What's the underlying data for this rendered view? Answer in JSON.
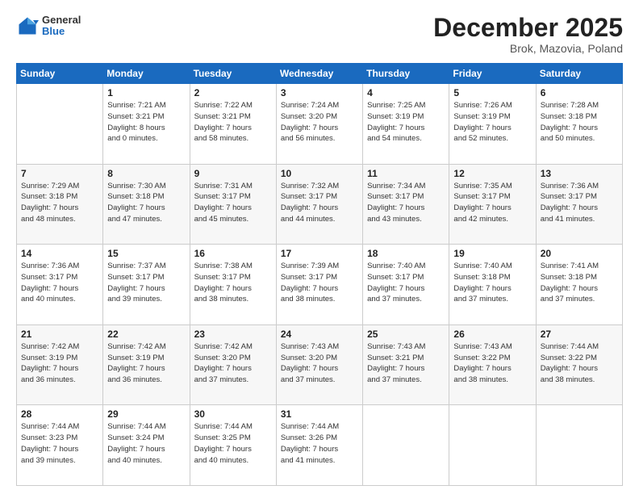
{
  "header": {
    "logo": {
      "general": "General",
      "blue": "Blue"
    },
    "title": "December 2025",
    "subtitle": "Brok, Mazovia, Poland"
  },
  "days_of_week": [
    "Sunday",
    "Monday",
    "Tuesday",
    "Wednesday",
    "Thursday",
    "Friday",
    "Saturday"
  ],
  "weeks": [
    [
      {
        "day": "",
        "lines": []
      },
      {
        "day": "1",
        "lines": [
          "Sunrise: 7:21 AM",
          "Sunset: 3:21 PM",
          "Daylight: 8 hours",
          "and 0 minutes."
        ]
      },
      {
        "day": "2",
        "lines": [
          "Sunrise: 7:22 AM",
          "Sunset: 3:21 PM",
          "Daylight: 7 hours",
          "and 58 minutes."
        ]
      },
      {
        "day": "3",
        "lines": [
          "Sunrise: 7:24 AM",
          "Sunset: 3:20 PM",
          "Daylight: 7 hours",
          "and 56 minutes."
        ]
      },
      {
        "day": "4",
        "lines": [
          "Sunrise: 7:25 AM",
          "Sunset: 3:19 PM",
          "Daylight: 7 hours",
          "and 54 minutes."
        ]
      },
      {
        "day": "5",
        "lines": [
          "Sunrise: 7:26 AM",
          "Sunset: 3:19 PM",
          "Daylight: 7 hours",
          "and 52 minutes."
        ]
      },
      {
        "day": "6",
        "lines": [
          "Sunrise: 7:28 AM",
          "Sunset: 3:18 PM",
          "Daylight: 7 hours",
          "and 50 minutes."
        ]
      }
    ],
    [
      {
        "day": "7",
        "lines": [
          "Sunrise: 7:29 AM",
          "Sunset: 3:18 PM",
          "Daylight: 7 hours",
          "and 48 minutes."
        ]
      },
      {
        "day": "8",
        "lines": [
          "Sunrise: 7:30 AM",
          "Sunset: 3:18 PM",
          "Daylight: 7 hours",
          "and 47 minutes."
        ]
      },
      {
        "day": "9",
        "lines": [
          "Sunrise: 7:31 AM",
          "Sunset: 3:17 PM",
          "Daylight: 7 hours",
          "and 45 minutes."
        ]
      },
      {
        "day": "10",
        "lines": [
          "Sunrise: 7:32 AM",
          "Sunset: 3:17 PM",
          "Daylight: 7 hours",
          "and 44 minutes."
        ]
      },
      {
        "day": "11",
        "lines": [
          "Sunrise: 7:34 AM",
          "Sunset: 3:17 PM",
          "Daylight: 7 hours",
          "and 43 minutes."
        ]
      },
      {
        "day": "12",
        "lines": [
          "Sunrise: 7:35 AM",
          "Sunset: 3:17 PM",
          "Daylight: 7 hours",
          "and 42 minutes."
        ]
      },
      {
        "day": "13",
        "lines": [
          "Sunrise: 7:36 AM",
          "Sunset: 3:17 PM",
          "Daylight: 7 hours",
          "and 41 minutes."
        ]
      }
    ],
    [
      {
        "day": "14",
        "lines": [
          "Sunrise: 7:36 AM",
          "Sunset: 3:17 PM",
          "Daylight: 7 hours",
          "and 40 minutes."
        ]
      },
      {
        "day": "15",
        "lines": [
          "Sunrise: 7:37 AM",
          "Sunset: 3:17 PM",
          "Daylight: 7 hours",
          "and 39 minutes."
        ]
      },
      {
        "day": "16",
        "lines": [
          "Sunrise: 7:38 AM",
          "Sunset: 3:17 PM",
          "Daylight: 7 hours",
          "and 38 minutes."
        ]
      },
      {
        "day": "17",
        "lines": [
          "Sunrise: 7:39 AM",
          "Sunset: 3:17 PM",
          "Daylight: 7 hours",
          "and 38 minutes."
        ]
      },
      {
        "day": "18",
        "lines": [
          "Sunrise: 7:40 AM",
          "Sunset: 3:17 PM",
          "Daylight: 7 hours",
          "and 37 minutes."
        ]
      },
      {
        "day": "19",
        "lines": [
          "Sunrise: 7:40 AM",
          "Sunset: 3:18 PM",
          "Daylight: 7 hours",
          "and 37 minutes."
        ]
      },
      {
        "day": "20",
        "lines": [
          "Sunrise: 7:41 AM",
          "Sunset: 3:18 PM",
          "Daylight: 7 hours",
          "and 37 minutes."
        ]
      }
    ],
    [
      {
        "day": "21",
        "lines": [
          "Sunrise: 7:42 AM",
          "Sunset: 3:19 PM",
          "Daylight: 7 hours",
          "and 36 minutes."
        ]
      },
      {
        "day": "22",
        "lines": [
          "Sunrise: 7:42 AM",
          "Sunset: 3:19 PM",
          "Daylight: 7 hours",
          "and 36 minutes."
        ]
      },
      {
        "day": "23",
        "lines": [
          "Sunrise: 7:42 AM",
          "Sunset: 3:20 PM",
          "Daylight: 7 hours",
          "and 37 minutes."
        ]
      },
      {
        "day": "24",
        "lines": [
          "Sunrise: 7:43 AM",
          "Sunset: 3:20 PM",
          "Daylight: 7 hours",
          "and 37 minutes."
        ]
      },
      {
        "day": "25",
        "lines": [
          "Sunrise: 7:43 AM",
          "Sunset: 3:21 PM",
          "Daylight: 7 hours",
          "and 37 minutes."
        ]
      },
      {
        "day": "26",
        "lines": [
          "Sunrise: 7:43 AM",
          "Sunset: 3:22 PM",
          "Daylight: 7 hours",
          "and 38 minutes."
        ]
      },
      {
        "day": "27",
        "lines": [
          "Sunrise: 7:44 AM",
          "Sunset: 3:22 PM",
          "Daylight: 7 hours",
          "and 38 minutes."
        ]
      }
    ],
    [
      {
        "day": "28",
        "lines": [
          "Sunrise: 7:44 AM",
          "Sunset: 3:23 PM",
          "Daylight: 7 hours",
          "and 39 minutes."
        ]
      },
      {
        "day": "29",
        "lines": [
          "Sunrise: 7:44 AM",
          "Sunset: 3:24 PM",
          "Daylight: 7 hours",
          "and 40 minutes."
        ]
      },
      {
        "day": "30",
        "lines": [
          "Sunrise: 7:44 AM",
          "Sunset: 3:25 PM",
          "Daylight: 7 hours",
          "and 40 minutes."
        ]
      },
      {
        "day": "31",
        "lines": [
          "Sunrise: 7:44 AM",
          "Sunset: 3:26 PM",
          "Daylight: 7 hours",
          "and 41 minutes."
        ]
      },
      {
        "day": "",
        "lines": []
      },
      {
        "day": "",
        "lines": []
      },
      {
        "day": "",
        "lines": []
      }
    ]
  ]
}
